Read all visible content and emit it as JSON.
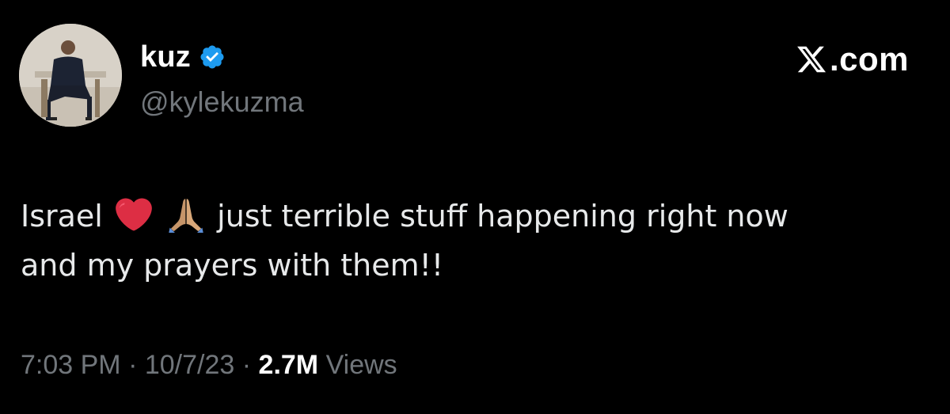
{
  "author": {
    "display_name": "kuz",
    "handle": "@kylekuzma",
    "verified_icon": "verified-badge-icon"
  },
  "brand": {
    "text": ".com",
    "logo_icon": "x-logo-icon"
  },
  "tweet": {
    "line1_part1": "Israel",
    "line1_part2": "just terrible stuff happening right now",
    "line2": "and my prayers with them!!",
    "emojis": [
      "red-heart-emoji",
      "folded-hands-emoji"
    ]
  },
  "meta": {
    "time": "7:03 PM",
    "separator": "·",
    "date": "10/7/23",
    "views_count": "2.7M",
    "views_label": "Views"
  },
  "colors": {
    "background": "#000000",
    "text_primary": "#e7e9ea",
    "text_secondary": "#71767b",
    "verified": "#1d9bf0",
    "heart": "#e0245e"
  }
}
